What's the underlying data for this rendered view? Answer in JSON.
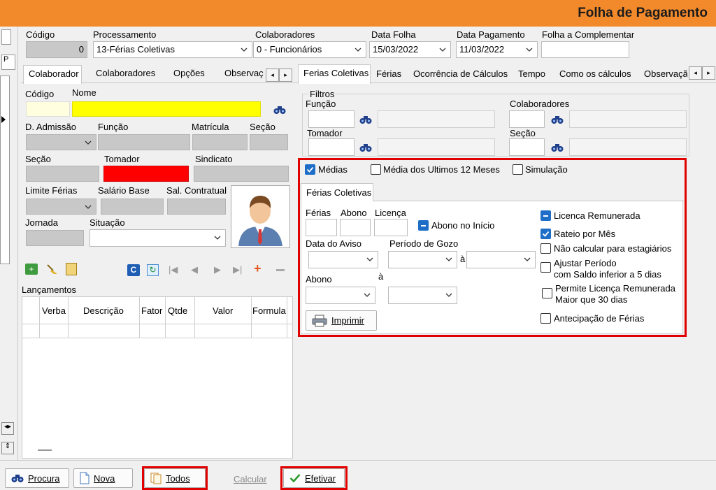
{
  "window": {
    "title": "Folha de Pagamento"
  },
  "header": {
    "codigo_label": "Código",
    "codigo_value": "0",
    "processamento_label": "Processamento",
    "processamento_value": "13-Férias Coletivas",
    "colaboradores_label": "Colaboradores",
    "colaboradores_value": "0 - Funcionários",
    "data_folha_label": "Data Folha",
    "data_folha_value": "15/03/2022",
    "data_pagamento_label": "Data Pagamento",
    "data_pagamento_value": "11/03/2022",
    "folha_complementar_label": "Folha a Complementar"
  },
  "left_tabs": [
    "Colaborador",
    "Colaboradores",
    "Opções",
    "Observaç"
  ],
  "left": {
    "codigo_label": "Código",
    "nome_label": "Nome",
    "admissao_label": "D. Admissão",
    "funcao_label": "Função",
    "matricula_label": "Matrícula",
    "secao_label": "Seção",
    "secao2_label": "Seção",
    "tomador_label": "Tomador",
    "sindicato_label": "Sindicato",
    "limite_ferias_label": "Limite Férias",
    "salario_base_label": "Salário Base",
    "sal_contratual_label": "Sal. Contratual",
    "jornada_label": "Jornada",
    "situacao_label": "Situação",
    "lancamentos_label": "Lançamentos",
    "grid_columns": [
      "Verba",
      "Descrição",
      "Fator",
      "Qtde",
      "Valor",
      "Formula"
    ]
  },
  "right_tabs": [
    "Ferias Coletivas",
    "Férias",
    "Ocorrência de Cálculos",
    "Tempo",
    "Como os cálculos",
    "Observaçã"
  ],
  "filtros": {
    "title": "Filtros",
    "funcao_label": "Função",
    "colaboradores_label": "Colaboradores",
    "tomador_label": "Tomador",
    "secao_label": "Seção"
  },
  "options": {
    "medias_label": "Médias",
    "medias_checked": true,
    "media12_label": "Média dos Ultimos 12 Meses",
    "media12_checked": false,
    "simulacao_label": "Simulação",
    "simulacao_checked": false
  },
  "ferias_coletivas": {
    "tab_label": "Férias Coletivas",
    "ferias_label": "Férias",
    "abono_label": "Abono",
    "licenca_label": "Licença",
    "abono_inicio_label": "Abono no Início",
    "data_aviso_label": "Data do Aviso",
    "periodo_gozo_label": "Período de Gozo",
    "a_label": "à",
    "abono2_label": "Abono",
    "imprimir_label": "Imprimir",
    "licenca_remunerada_label": "Licenca Remunerada",
    "rateio_label": "Rateio por Mês",
    "nao_calcular_label": "Não calcular para estagiários",
    "ajustar_label_1": "Ajustar Período",
    "ajustar_label_2": "com Saldo inferior a 5 dias",
    "permite_label_1": "Permite Licença Remunerada",
    "permite_label_2": "Maior que 30 dias",
    "antecipacao_label": "Antecipação de Férias"
  },
  "footer": {
    "procura": "Procura",
    "nova": "Nova",
    "todos": "Todos",
    "calcular": "Calcular",
    "efetivar": "Efetivar"
  },
  "colors": {
    "title_bar": "#f28a2c",
    "highlight_red": "#e00000",
    "nome_field": "#ffff00",
    "tomador_field": "#ff0000",
    "codigo_field": "#ffffe0",
    "check_blue": "#1e6ec8"
  }
}
